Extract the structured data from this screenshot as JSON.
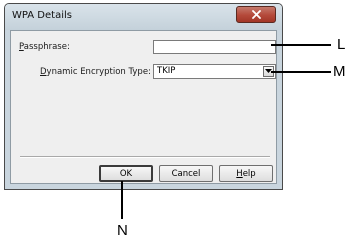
{
  "window": {
    "title": "WPA Details"
  },
  "fields": {
    "passphrase": {
      "label_ul": "P",
      "label_rest": "assphrase:",
      "value": ""
    },
    "encryption": {
      "label_pre": "",
      "label_ul": "D",
      "label_rest": "ynamic Encryption Type:",
      "selected": "TKIP"
    }
  },
  "buttons": {
    "ok": "OK",
    "cancel": "Cancel",
    "help_ul": "H",
    "help_rest": "elp"
  },
  "callouts": {
    "l": "L",
    "m": "M",
    "n": "N"
  },
  "icons": {
    "close": "close-icon",
    "dropdown": "chevron-down-icon"
  }
}
